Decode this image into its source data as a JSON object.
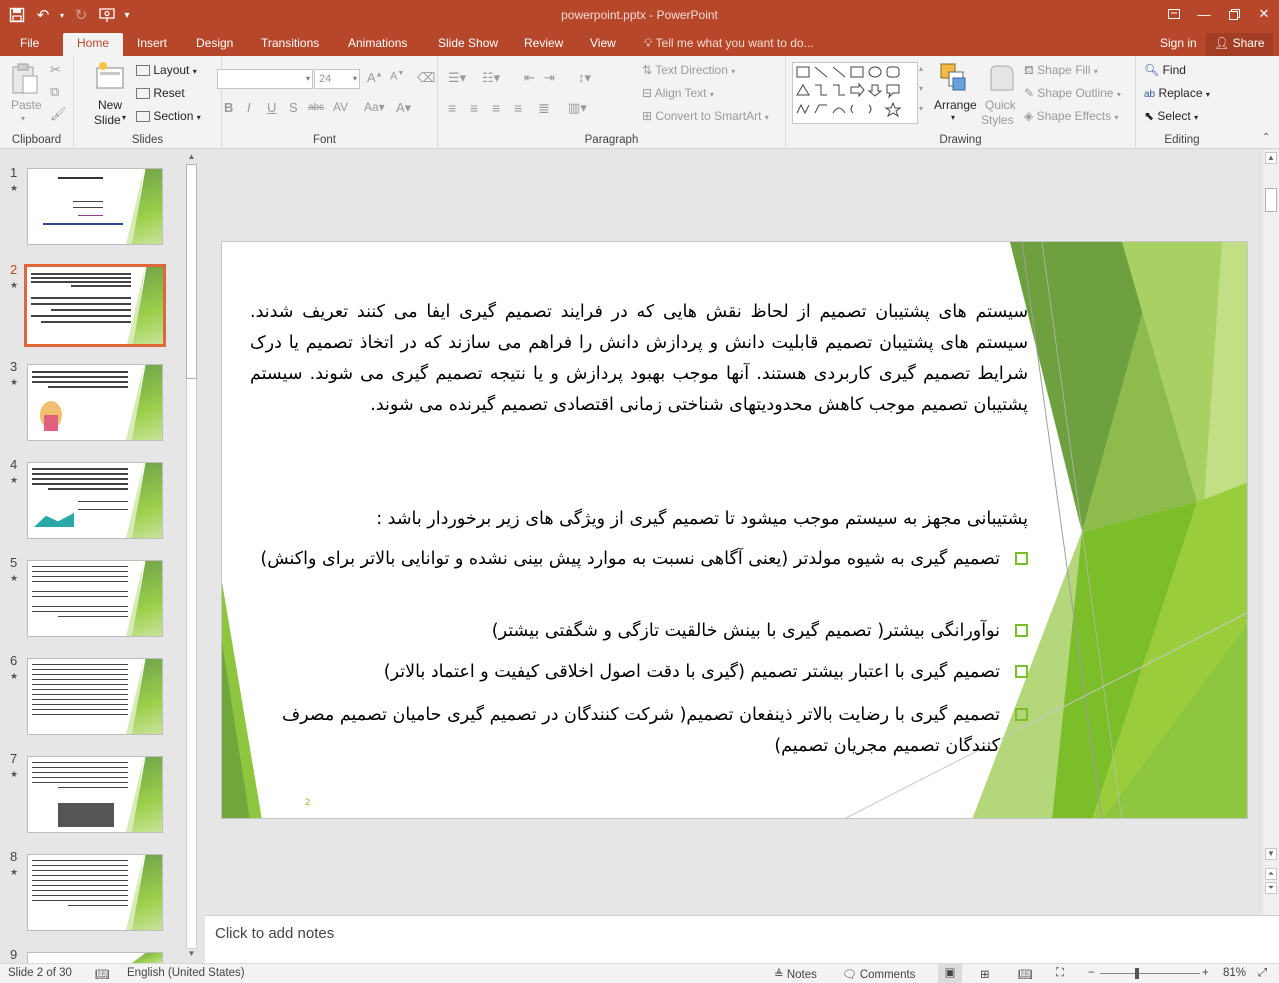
{
  "app": {
    "title": "powerpoint.pptx - PowerPoint",
    "colors": {
      "accent": "#b7472a",
      "bullet": "#7cbd2a",
      "slide_green": "#6fa73d"
    }
  },
  "qat": {
    "save_icon": "save-icon",
    "undo_icon": "undo-icon",
    "redo_icon": "redo-icon",
    "present_icon": "present-icon",
    "customize_icon": "customize-icon"
  },
  "tabs": [
    {
      "label": "File"
    },
    {
      "label": "Home"
    },
    {
      "label": "Insert"
    },
    {
      "label": "Design"
    },
    {
      "label": "Transitions"
    },
    {
      "label": "Animations"
    },
    {
      "label": "Slide Show"
    },
    {
      "label": "Review"
    },
    {
      "label": "View"
    }
  ],
  "tell_me": "Tell me what you want to do...",
  "sign_in": "Sign in",
  "share": "Share",
  "ribbon": {
    "clipboard": {
      "label": "Clipboard",
      "paste": "Paste"
    },
    "slides": {
      "label": "Slides",
      "new_slide_1": "New",
      "new_slide_2": "Slide",
      "layout": "Layout",
      "reset": "Reset",
      "section": "Section"
    },
    "font": {
      "label": "Font",
      "font_name": "",
      "font_size": "24"
    },
    "paragraph": {
      "label": "Paragraph",
      "text_direction": "Text Direction",
      "align_text": "Align Text",
      "smartart": "Convert to SmartArt"
    },
    "drawing": {
      "label": "Drawing",
      "arrange": "Arrange",
      "quick_styles_1": "Quick",
      "quick_styles_2": "Styles",
      "shape_fill": "Shape Fill",
      "shape_outline": "Shape Outline",
      "shape_effects": "Shape Effects"
    },
    "editing": {
      "label": "Editing",
      "find": "Find",
      "replace": "Replace",
      "select": "Select"
    }
  },
  "thumbnails": [
    {
      "num": "1"
    },
    {
      "num": "2"
    },
    {
      "num": "3"
    },
    {
      "num": "4"
    },
    {
      "num": "5"
    },
    {
      "num": "6"
    },
    {
      "num": "7"
    },
    {
      "num": "8"
    },
    {
      "num": "9"
    }
  ],
  "slide": {
    "paragraph1": "سیستم های پشتیبان تصمیم از لحاظ نقش هایی که در فرایند تصمیم گیری ایفا می کنند تعریف شدند. سیستم های پشتیبان تصمیم قابلیت دانش و پردازش دانش را فراهم می سازند که در اتخاذ تصمیم یا درک شرایط تصمیم گیری کاربردی هستند. آنها موجب بهبود پردازش و یا نتیجه تصمیم گیری می شوند. سیستم پشتیبان تصمیم موجب کاهش محدودیتهای شناختی زمانی اقتصادی تصمیم گیرنده می شوند.",
    "paragraph2": "پشتیبانی مجهز به سیستم موجب میشود تا تصمیم گیری از ویژگی های زیر برخوردار باشد :",
    "bullets": [
      "تصمیم گیری به شیوه مولدتر (یعنی آگاهی نسبت به موارد پیش بینی نشده و توانایی بالاتر برای واکنش)",
      "نوآورانگی بیشتر( تصمیم گیری با بینش خالقیت تازگی و شگفتی بیشتر)",
      "تصمیم گیری با اعتبار بیشتر تصمیم (گیری با دقت اصول اخلاقی کیفیت و اعتماد بالاتر)",
      "تصمیم گیری با رضایت بالاتر ذینفعان تصمیم( شرکت کنندگان در تصمیم گیری حامیان تصمیم مصرف کنندگان تصمیم مجریان تصمیم)"
    ],
    "number": "2"
  },
  "notes_placeholder": "Click to add notes",
  "status": {
    "slide_of": "Slide 2 of 30",
    "language": "English (United States)",
    "notes": "Notes",
    "comments": "Comments",
    "zoom": "81%"
  }
}
